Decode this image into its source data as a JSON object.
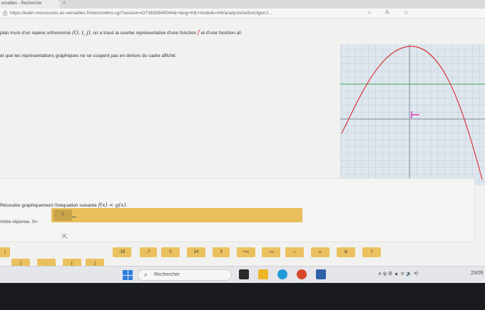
{
  "browser": {
    "tab_title": "ersailles - Recherche",
    "tab_close": "×",
    "url": "https://euler-ressources.ac-versailles.fr/wims/wims.cgi?session=O7363584904​4&+lang=fr&+module=H4/analysis/oefonctgen.f...",
    "icons": {
      "page": "page-icon",
      "zoom": "magnifier-icon",
      "read_aloud": "read-aloud-icon",
      "favorite": "star-icon"
    }
  },
  "exercise": {
    "line1_a": "plan muni d'un repère orthonormé ",
    "line1_math": "(O, i, j)",
    "line1_b": ", on a tracé la courbe représentative d'une fonction ",
    "line1_f": "f",
    "line1_c": " et d'une fonction af-",
    "line2": "et que les représentations graphiques ne se coupent pas en dehors du cadre affiché."
  },
  "graph": {
    "colors": {
      "background": "#dfe7ee",
      "grid": "#c2d0dc",
      "axis": "#7c8a96",
      "f_curve": "#d8383a",
      "g_line": "#4aa85a",
      "marker": "#d62fb3"
    }
  },
  "question": {
    "text_a": "Résoudre graphiquement l'inéquation suivante ",
    "text_math": "f(x) < g(x)",
    "text_b": ".",
    "answer_label": "Votre réponse. S=",
    "answer_placeholder": "?"
  },
  "keyboard": {
    "top_row": [
      ")",
      "-18",
      "-7",
      "0",
      "14",
      "3",
      "+∞",
      "−∞",
      "∩",
      "∪",
      "ℝ",
      "?"
    ],
    "bottom_row": [
      "]",
      ";",
      "[",
      "]"
    ]
  },
  "taskbar": {
    "search_placeholder": "Rechercher",
    "tray_text": "∧  ψ  ⚙  ▲  ᯤ  🔈  ⟲",
    "time": "23/05"
  }
}
